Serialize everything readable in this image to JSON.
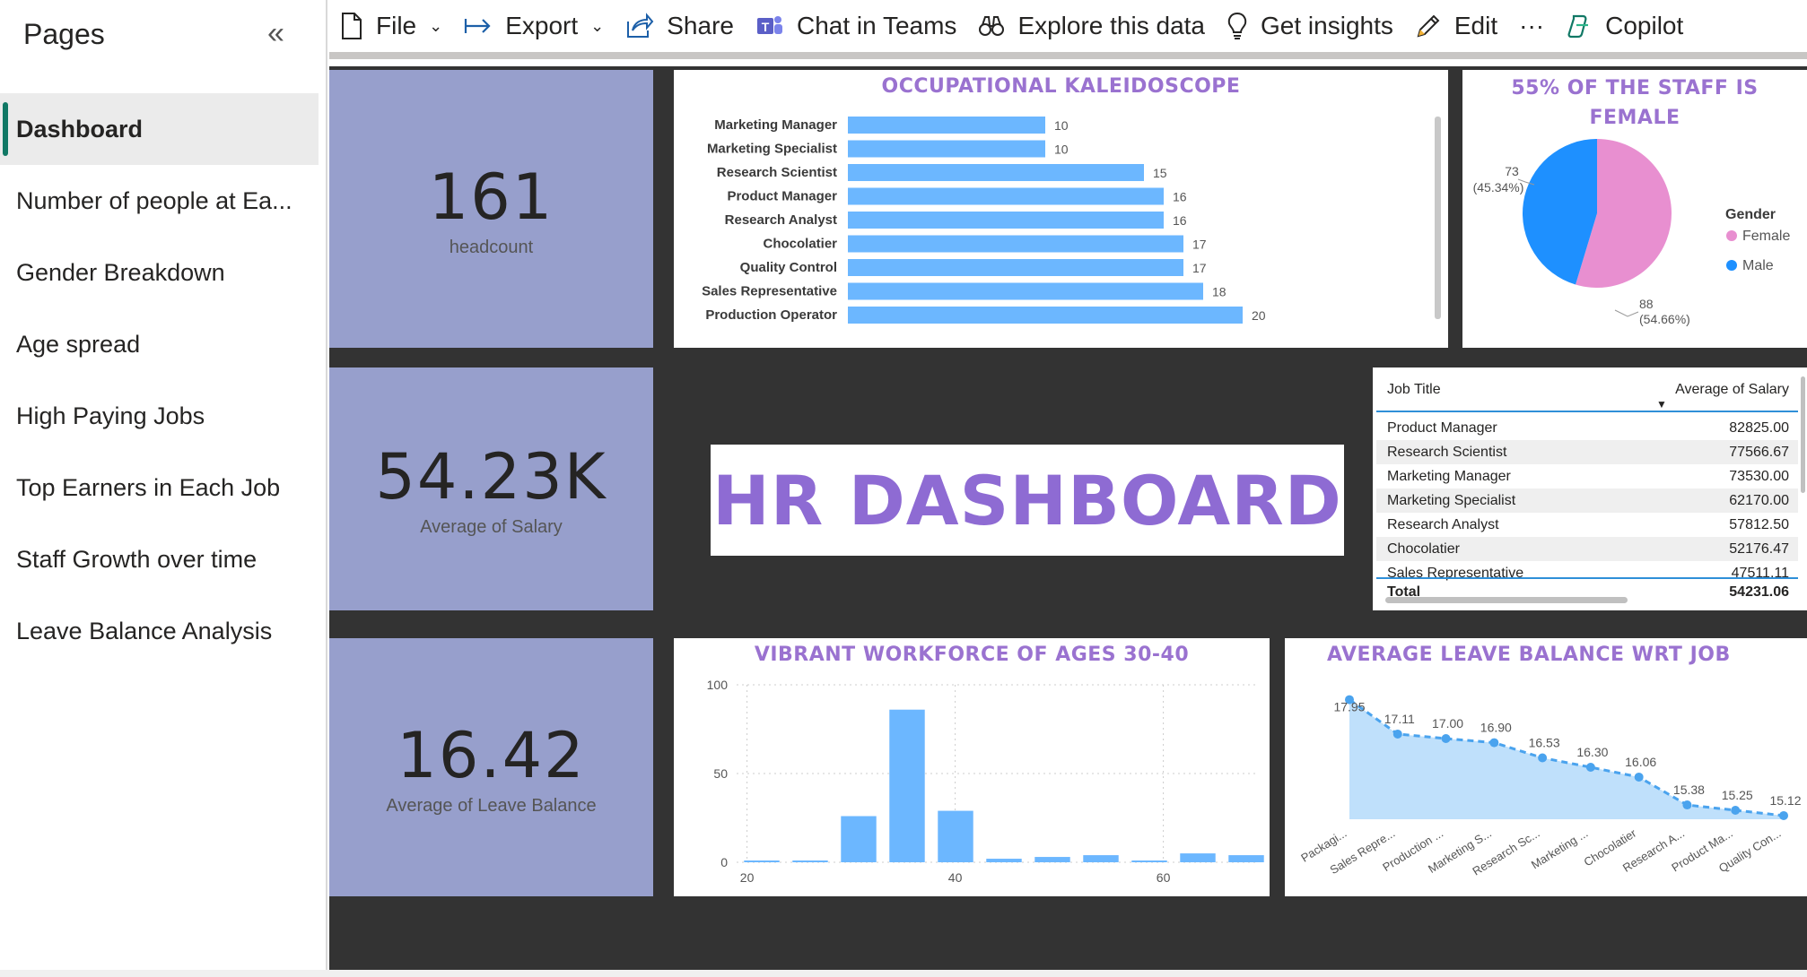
{
  "sidebar": {
    "title": "Pages",
    "collapse_glyph": "«",
    "items": [
      {
        "label": "Dashboard"
      },
      {
        "label": "Number of people at Ea..."
      },
      {
        "label": "Gender Breakdown"
      },
      {
        "label": "Age spread"
      },
      {
        "label": "High Paying Jobs"
      },
      {
        "label": "Top Earners in Each Job"
      },
      {
        "label": "Staff Growth over time"
      },
      {
        "label": "Leave Balance Analysis"
      }
    ]
  },
  "toolbar": {
    "file": "File",
    "export": "Export",
    "share": "Share",
    "chat": "Chat in Teams",
    "explore": "Explore this data",
    "insights": "Get insights",
    "edit": "Edit",
    "more": "···",
    "copilot": "Copilot"
  },
  "kpis": {
    "headcount": {
      "value": "161",
      "label": "headcount"
    },
    "salary": {
      "value": "54.23K",
      "label": "Average of Salary"
    },
    "leave": {
      "value": "16.42",
      "label": "Average of Leave Balance"
    }
  },
  "banner": "HR DASHBOARD",
  "salary_table": {
    "col1": "Job Title",
    "col2": "Average of Salary",
    "rows": [
      {
        "job": "Product Manager",
        "salary": "82825.00"
      },
      {
        "job": "Research Scientist",
        "salary": "77566.67"
      },
      {
        "job": "Marketing Manager",
        "salary": "73530.00"
      },
      {
        "job": "Marketing Specialist",
        "salary": "62170.00"
      },
      {
        "job": "Research Analyst",
        "salary": "57812.50"
      },
      {
        "job": "Chocolatier",
        "salary": "52176.47"
      },
      {
        "job": "Sales Representative",
        "salary": "47511.11"
      }
    ],
    "total_label": "Total",
    "total_value": "54231.06"
  },
  "colors": {
    "accent_purple": "#9a72d0",
    "bar_blue": "#6cb7ff",
    "female_pink": "#e88fd0",
    "male_blue": "#1e90ff",
    "kpi_bg": "#979fcc",
    "canvas_bg": "#333333"
  },
  "chart_data": [
    {
      "type": "bar",
      "orientation": "horizontal",
      "title": "OCCUPATIONAL KALEIDOSCOPE",
      "categories": [
        "Marketing Manager",
        "Marketing Specialist",
        "Research Scientist",
        "Product Manager",
        "Research Analyst",
        "Chocolatier",
        "Quality Control",
        "Sales Representative",
        "Production Operator"
      ],
      "values": [
        10,
        10,
        15,
        16,
        16,
        17,
        17,
        18,
        20
      ]
    },
    {
      "type": "pie",
      "title": "55% OF THE STAFF IS FEMALE",
      "legend_title": "Gender",
      "legend_position": "right",
      "slices": [
        {
          "name": "Female",
          "value": 88,
          "label": "88",
          "pct_label": "(54.66%)"
        },
        {
          "name": "Male",
          "value": 73,
          "label": "73",
          "pct_label": "(45.34%)"
        }
      ]
    },
    {
      "type": "bar",
      "title": "VIBRANT WORKFORCE OF AGES 30-40",
      "x_ticks": [
        20,
        40,
        60
      ],
      "y_ticks": [
        0,
        50,
        100
      ],
      "ylim": [
        0,
        100
      ],
      "xlim": [
        19,
        69
      ],
      "bin_width": 5,
      "bins": [
        {
          "x": 22,
          "value": 1
        },
        {
          "x": 27,
          "value": 1
        },
        {
          "x": 32,
          "value": 26
        },
        {
          "x": 37,
          "value": 86
        },
        {
          "x": 42,
          "value": 29
        },
        {
          "x": 47,
          "value": 2
        },
        {
          "x": 52,
          "value": 3
        },
        {
          "x": 57,
          "value": 4
        },
        {
          "x": 62,
          "value": 1
        },
        {
          "x": 67,
          "value": 5
        },
        {
          "x": 72,
          "value": 4
        }
      ]
    },
    {
      "type": "area",
      "title": "AVERAGE LEAVE BALANCE WRT JOB",
      "categories": [
        "Packagi...",
        "Sales Repre...",
        "Production ...",
        "Marketing S...",
        "Research Sc...",
        "Marketing ...",
        "Chocolatier",
        "Research A...",
        "Product Ma...",
        "Quality Con..."
      ],
      "values": [
        17.95,
        17.11,
        17.0,
        16.9,
        16.53,
        16.3,
        16.06,
        15.38,
        15.25,
        15.12
      ],
      "value_labels": [
        "17.95",
        "17.11",
        "17.00",
        "16.90",
        "16.53",
        "16.30",
        "16.06",
        "15.38",
        "15.25",
        "15.12"
      ]
    }
  ]
}
